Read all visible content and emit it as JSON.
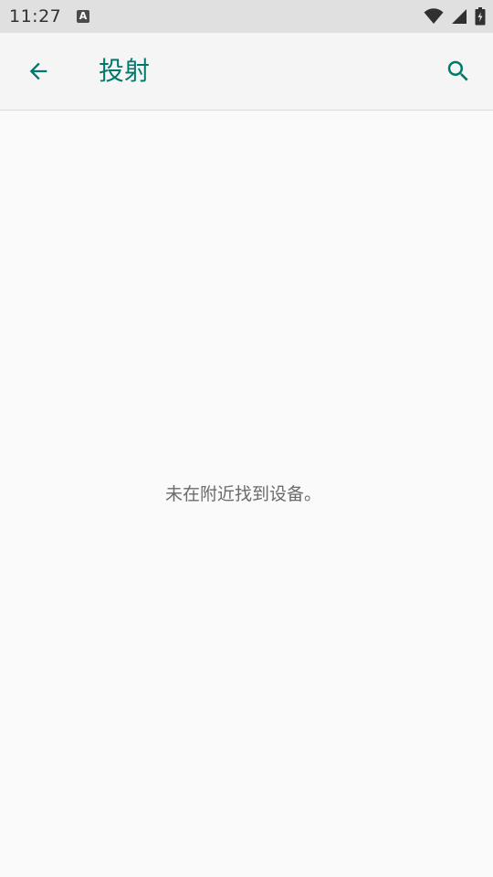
{
  "status_bar": {
    "time": "11:27",
    "notification_icon_glyph": "A",
    "notification_icon_name": "keyboard-notification-icon",
    "icons": [
      "wifi-icon",
      "cell-signal-icon",
      "battery-icon"
    ]
  },
  "app_bar": {
    "title": "投射",
    "back_icon": "arrow-back-icon",
    "search_icon": "search-icon",
    "accent_color": "#00796b"
  },
  "content": {
    "empty_message": "未在附近找到设备。"
  },
  "colors": {
    "status_bar_bg": "#e0e0e0",
    "app_bar_bg": "#f5f5f5",
    "background": "#fafafa",
    "message_text": "#6b6b6b"
  }
}
